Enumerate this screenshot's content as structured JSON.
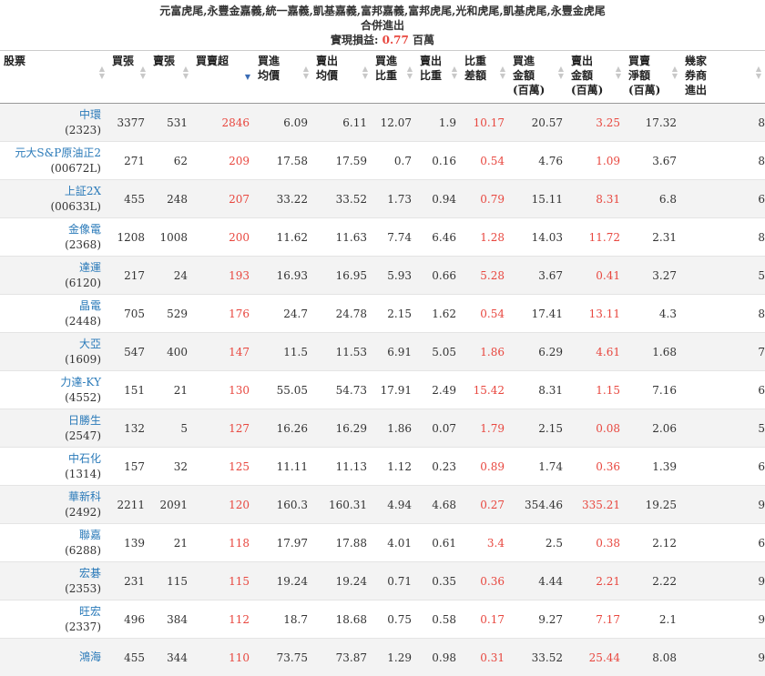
{
  "header": {
    "title": "元富虎尾,永豐金嘉義,統一嘉義,凱基嘉義,富邦嘉義,富邦虎尾,光和虎尾,凱基虎尾,永豐金虎尾",
    "subtitle": "合併進出",
    "pl_label": "實現損益:",
    "pl_value": "0.77",
    "pl_unit": "百萬"
  },
  "columns": [
    {
      "label": "股票"
    },
    {
      "label": "買張"
    },
    {
      "label": "賣張"
    },
    {
      "label": "買賣超"
    },
    {
      "label": "買進均價"
    },
    {
      "label": "賣出均價"
    },
    {
      "label": "買進比重"
    },
    {
      "label": "賣出比重"
    },
    {
      "label": "比重差額"
    },
    {
      "label": "買進金額(百萬)"
    },
    {
      "label": "賣出金額(百萬)"
    },
    {
      "label": "買賣淨額(百萬)"
    },
    {
      "label": "幾家券商進出"
    }
  ],
  "rows": [
    {
      "name": "中環",
      "code": "(2323)",
      "buy": "3377",
      "sell": "531",
      "net": "2846",
      "buy_avg": "6.09",
      "sell_avg": "6.11",
      "buy_pct": "12.07",
      "sell_pct": "1.9",
      "pct_diff": "10.17",
      "buy_amt": "20.57",
      "sell_amt": "3.25",
      "net_amt": "17.32",
      "brokers": "8"
    },
    {
      "name": "元大S&P原油正2",
      "code": "(00672L)",
      "buy": "271",
      "sell": "62",
      "net": "209",
      "buy_avg": "17.58",
      "sell_avg": "17.59",
      "buy_pct": "0.7",
      "sell_pct": "0.16",
      "pct_diff": "0.54",
      "buy_amt": "4.76",
      "sell_amt": "1.09",
      "net_amt": "3.67",
      "brokers": "8"
    },
    {
      "name": "上証2X",
      "code": "(00633L)",
      "buy": "455",
      "sell": "248",
      "net": "207",
      "buy_avg": "33.22",
      "sell_avg": "33.52",
      "buy_pct": "1.73",
      "sell_pct": "0.94",
      "pct_diff": "0.79",
      "buy_amt": "15.11",
      "sell_amt": "8.31",
      "net_amt": "6.8",
      "brokers": "6"
    },
    {
      "name": "金像電",
      "code": "(2368)",
      "buy": "1208",
      "sell": "1008",
      "net": "200",
      "buy_avg": "11.62",
      "sell_avg": "11.63",
      "buy_pct": "7.74",
      "sell_pct": "6.46",
      "pct_diff": "1.28",
      "buy_amt": "14.03",
      "sell_amt": "11.72",
      "net_amt": "2.31",
      "brokers": "8"
    },
    {
      "name": "達運",
      "code": "(6120)",
      "buy": "217",
      "sell": "24",
      "net": "193",
      "buy_avg": "16.93",
      "sell_avg": "16.95",
      "buy_pct": "5.93",
      "sell_pct": "0.66",
      "pct_diff": "5.28",
      "buy_amt": "3.67",
      "sell_amt": "0.41",
      "net_amt": "3.27",
      "brokers": "5"
    },
    {
      "name": "晶電",
      "code": "(2448)",
      "buy": "705",
      "sell": "529",
      "net": "176",
      "buy_avg": "24.7",
      "sell_avg": "24.78",
      "buy_pct": "2.15",
      "sell_pct": "1.62",
      "pct_diff": "0.54",
      "buy_amt": "17.41",
      "sell_amt": "13.11",
      "net_amt": "4.3",
      "brokers": "8"
    },
    {
      "name": "大亞",
      "code": "(1609)",
      "buy": "547",
      "sell": "400",
      "net": "147",
      "buy_avg": "11.5",
      "sell_avg": "11.53",
      "buy_pct": "6.91",
      "sell_pct": "5.05",
      "pct_diff": "1.86",
      "buy_amt": "6.29",
      "sell_amt": "4.61",
      "net_amt": "1.68",
      "brokers": "7"
    },
    {
      "name": "力達-KY",
      "code": "(4552)",
      "buy": "151",
      "sell": "21",
      "net": "130",
      "buy_avg": "55.05",
      "sell_avg": "54.73",
      "buy_pct": "17.91",
      "sell_pct": "2.49",
      "pct_diff": "15.42",
      "buy_amt": "8.31",
      "sell_amt": "1.15",
      "net_amt": "7.16",
      "brokers": "6"
    },
    {
      "name": "日勝生",
      "code": "(2547)",
      "buy": "132",
      "sell": "5",
      "net": "127",
      "buy_avg": "16.26",
      "sell_avg": "16.29",
      "buy_pct": "1.86",
      "sell_pct": "0.07",
      "pct_diff": "1.79",
      "buy_amt": "2.15",
      "sell_amt": "0.08",
      "net_amt": "2.06",
      "brokers": "5"
    },
    {
      "name": "中石化",
      "code": "(1314)",
      "buy": "157",
      "sell": "32",
      "net": "125",
      "buy_avg": "11.11",
      "sell_avg": "11.13",
      "buy_pct": "1.12",
      "sell_pct": "0.23",
      "pct_diff": "0.89",
      "buy_amt": "1.74",
      "sell_amt": "0.36",
      "net_amt": "1.39",
      "brokers": "6"
    },
    {
      "name": "華新科",
      "code": "(2492)",
      "buy": "2211",
      "sell": "2091",
      "net": "120",
      "buy_avg": "160.3",
      "sell_avg": "160.31",
      "buy_pct": "4.94",
      "sell_pct": "4.68",
      "pct_diff": "0.27",
      "buy_amt": "354.46",
      "sell_amt": "335.21",
      "net_amt": "19.25",
      "brokers": "9"
    },
    {
      "name": "聯嘉",
      "code": "(6288)",
      "buy": "139",
      "sell": "21",
      "net": "118",
      "buy_avg": "17.97",
      "sell_avg": "17.88",
      "buy_pct": "4.01",
      "sell_pct": "0.61",
      "pct_diff": "3.4",
      "buy_amt": "2.5",
      "sell_amt": "0.38",
      "net_amt": "2.12",
      "brokers": "6"
    },
    {
      "name": "宏碁",
      "code": "(2353)",
      "buy": "231",
      "sell": "115",
      "net": "115",
      "buy_avg": "19.24",
      "sell_avg": "19.24",
      "buy_pct": "0.71",
      "sell_pct": "0.35",
      "pct_diff": "0.36",
      "buy_amt": "4.44",
      "sell_amt": "2.21",
      "net_amt": "2.22",
      "brokers": "9"
    },
    {
      "name": "旺宏",
      "code": "(2337)",
      "buy": "496",
      "sell": "384",
      "net": "112",
      "buy_avg": "18.7",
      "sell_avg": "18.68",
      "buy_pct": "0.75",
      "sell_pct": "0.58",
      "pct_diff": "0.17",
      "buy_amt": "9.27",
      "sell_amt": "7.17",
      "net_amt": "2.1",
      "brokers": "9"
    },
    {
      "name": "鴻海",
      "code": "",
      "buy": "455",
      "sell": "344",
      "net": "110",
      "buy_avg": "73.75",
      "sell_avg": "73.87",
      "buy_pct": "1.29",
      "sell_pct": "0.98",
      "pct_diff": "0.31",
      "buy_amt": "33.52",
      "sell_amt": "25.44",
      "net_amt": "8.08",
      "brokers": "9"
    }
  ]
}
